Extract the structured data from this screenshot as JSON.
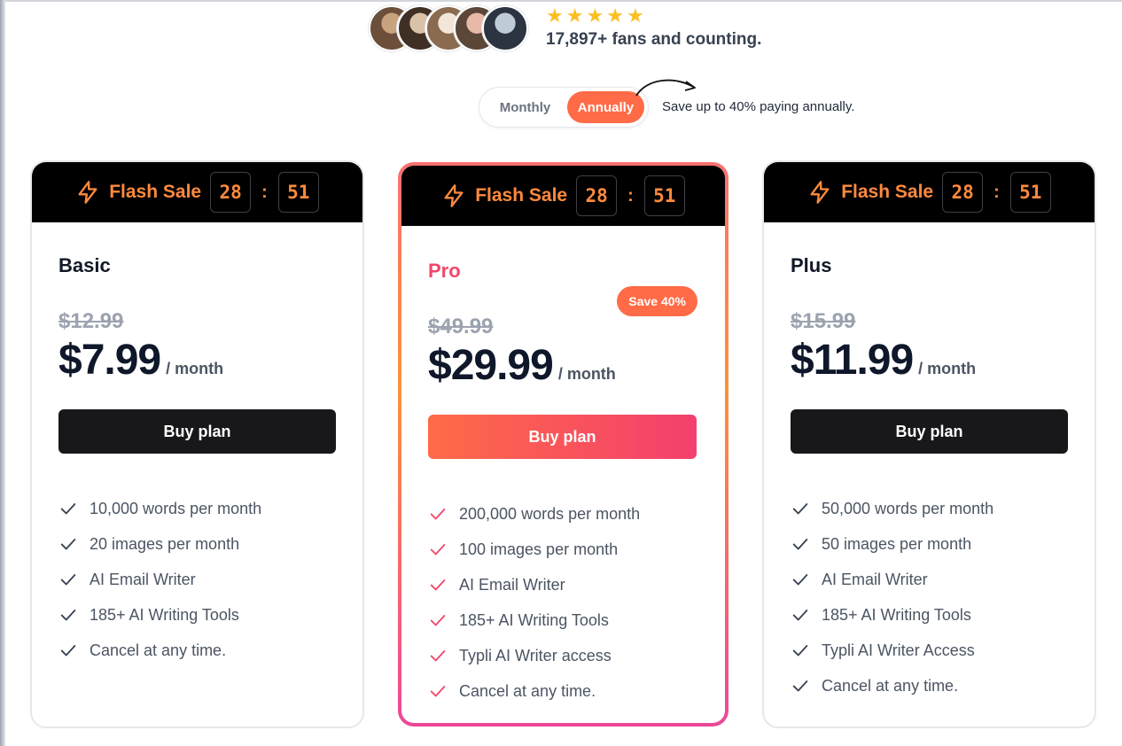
{
  "social": {
    "avatars": [
      {
        "name": "avatar-1",
        "colors": [
          "#c9a27e",
          "#6b4f3a"
        ]
      },
      {
        "name": "avatar-2",
        "colors": [
          "#d9c2a8",
          "#3f2f25"
        ]
      },
      {
        "name": "avatar-3",
        "colors": [
          "#f3e6d8",
          "#8a6b4f"
        ]
      },
      {
        "name": "avatar-4",
        "colors": [
          "#e8b9a6",
          "#5b4638"
        ]
      },
      {
        "name": "avatar-5",
        "colors": [
          "#bfcbd6",
          "#2b3440"
        ]
      }
    ],
    "star_count": 5,
    "fans_text": "17,897+ fans and counting."
  },
  "billing": {
    "monthly_label": "Monthly",
    "annually_label": "Annually",
    "selected": "Annually",
    "save_note": "Save up to 40% paying annually."
  },
  "flash_sale": {
    "label": "Flash Sale",
    "minutes": "28",
    "seconds": "51",
    "separator": ":"
  },
  "plans": [
    {
      "name": "Basic",
      "old_price": "$12.99",
      "price": "$7.99",
      "period": "/ month",
      "button": "Buy plan",
      "features": [
        "10,000 words per month",
        "20 images per month",
        "AI Email Writer",
        "185+ AI Writing Tools",
        "Cancel at any time."
      ]
    },
    {
      "name": "Pro",
      "badge": "Save 40%",
      "old_price": "$49.99",
      "price": "$29.99",
      "period": "/ month",
      "button": "Buy plan",
      "features": [
        "200,000 words per month",
        "100 images per month",
        "AI Email Writer",
        "185+ AI Writing Tools",
        "Typli AI Writer access",
        "Cancel at any time."
      ]
    },
    {
      "name": "Plus",
      "old_price": "$15.99",
      "price": "$11.99",
      "period": "/ month",
      "button": "Buy plan",
      "features": [
        "50,000 words per month",
        "50 images per month",
        "AI Email Writer",
        "185+ AI Writing Tools",
        "Typli AI Writer Access",
        "Cancel at any time."
      ]
    }
  ],
  "colors": {
    "accent": "#ff6b47",
    "pro_pink": "#f0486a",
    "flash_orange": "#ff8a3d",
    "star": "#fbbf24",
    "dark_button": "#18181b"
  },
  "icons": {
    "flash": "lightning-bolt-icon",
    "check": "checkmark-icon",
    "star": "star-icon",
    "arrow": "curved-arrow-icon"
  }
}
